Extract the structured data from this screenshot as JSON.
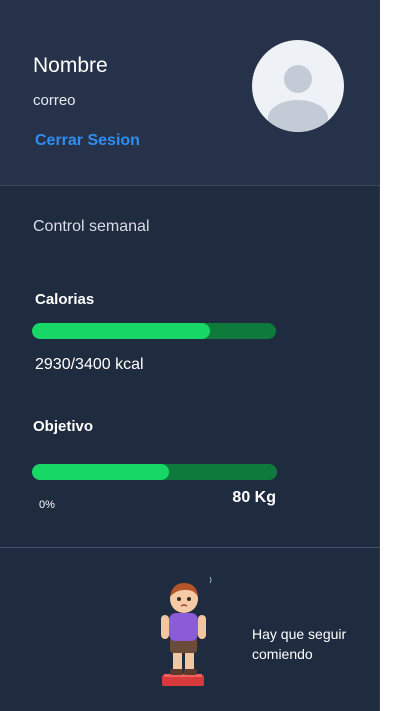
{
  "profile": {
    "name": "Nombre",
    "email": "correo",
    "logout_label": "Cerrar Sesion",
    "avatar_icon": "user-avatar-icon"
  },
  "weekly": {
    "title": "Control semanal",
    "calories": {
      "label": "Calorias",
      "value_text": "2930/3400 kcal",
      "consumed": 2930,
      "target": 3400,
      "progress": 0.73
    },
    "goal": {
      "label": "Objetivo",
      "percent_label": "0%",
      "weight_label": "80 Kg",
      "progress": 0.56
    }
  },
  "footer": {
    "message": "Hay que seguir comiendo",
    "illustration": "child-on-scale-illustration"
  },
  "colors": {
    "drawer_bg": "#1f2b3f",
    "header_bg": "#26324a",
    "accent_link": "#2f8ef0",
    "bar_fill": "#17d866",
    "bar_track": "#0e7a3c"
  }
}
